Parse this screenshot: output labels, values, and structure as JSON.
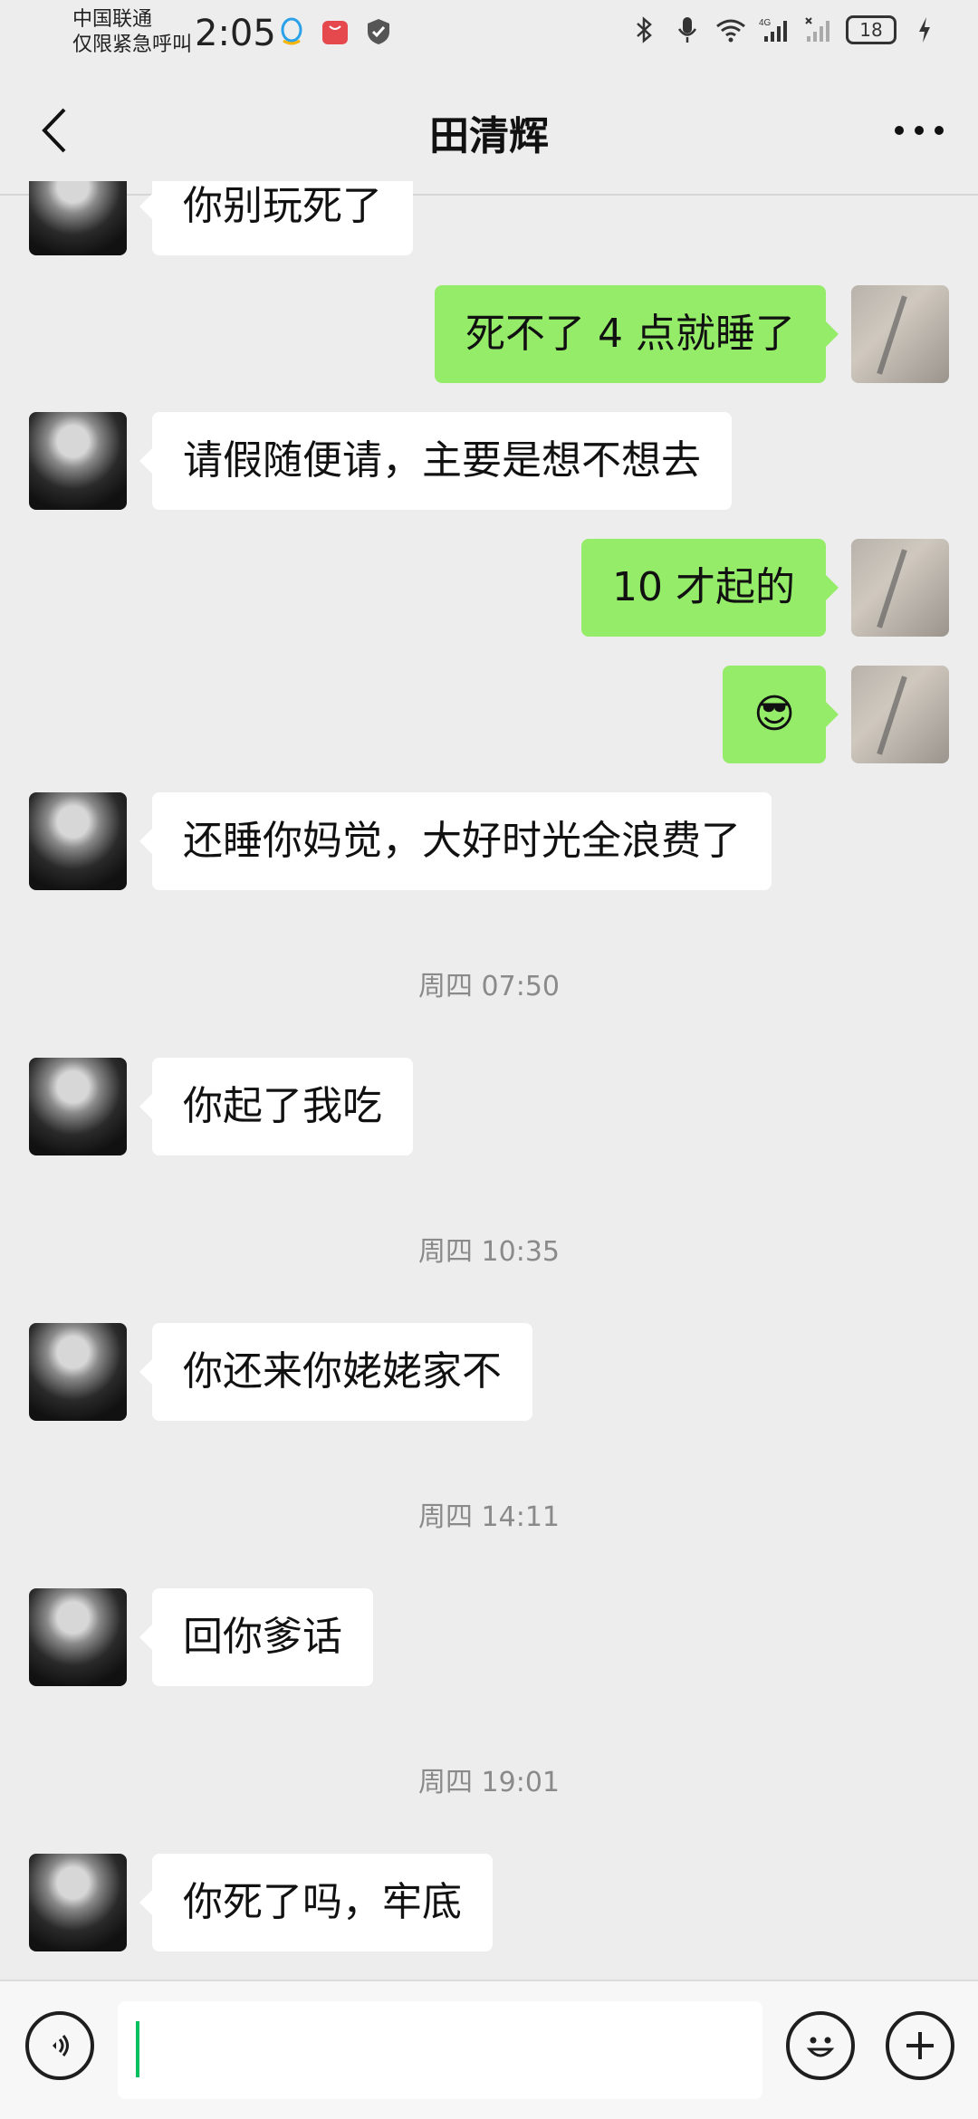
{
  "status_bar": {
    "carrier_line1": "中国联通",
    "carrier_line2": "仅限紧急呼叫",
    "time": "2:05",
    "battery": "18"
  },
  "header": {
    "title": "田清辉"
  },
  "messages": [
    {
      "side": "left",
      "text": "你别玩死了"
    },
    {
      "side": "right",
      "text": "死不了 4 点就睡了"
    },
    {
      "side": "left",
      "text": "请假随便请，主要是想不想去"
    },
    {
      "side": "right",
      "text": "10 才起的"
    },
    {
      "side": "right",
      "text": "😎"
    },
    {
      "side": "left",
      "text": "还睡你妈觉，大好时光全浪费了"
    },
    {
      "timestamp": "周四 07:50"
    },
    {
      "side": "left",
      "text": "你起了我吃"
    },
    {
      "timestamp": "周四 10:35"
    },
    {
      "side": "left",
      "text": "你还来你姥姥家不"
    },
    {
      "timestamp": "周四 14:11"
    },
    {
      "side": "left",
      "text": "回你爹话"
    },
    {
      "timestamp": "周四 19:01"
    },
    {
      "side": "left",
      "text": "你死了吗，牢底"
    }
  ],
  "input": {
    "placeholder": ""
  },
  "colors": {
    "self_bubble": "#95ec69",
    "friend_bubble": "#ffffff",
    "background": "#ededed",
    "cursor": "#07c160"
  }
}
